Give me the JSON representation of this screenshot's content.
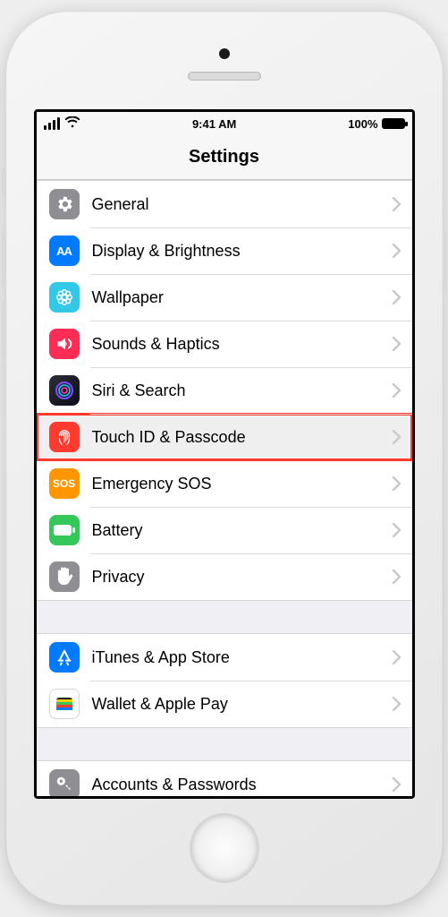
{
  "status_bar": {
    "time": "9:41 AM",
    "battery_pct": "100%"
  },
  "header": {
    "title": "Settings"
  },
  "groups": [
    {
      "items": [
        {
          "id": "general",
          "label": "General"
        },
        {
          "id": "display-brightness",
          "label": "Display & Brightness"
        },
        {
          "id": "wallpaper",
          "label": "Wallpaper"
        },
        {
          "id": "sounds-haptics",
          "label": "Sounds & Haptics"
        },
        {
          "id": "siri-search",
          "label": "Siri & Search"
        },
        {
          "id": "touch-id-passcode",
          "label": "Touch ID & Passcode",
          "highlight": true
        },
        {
          "id": "emergency-sos",
          "label": "Emergency SOS"
        },
        {
          "id": "battery",
          "label": "Battery"
        },
        {
          "id": "privacy",
          "label": "Privacy"
        }
      ]
    },
    {
      "items": [
        {
          "id": "itunes-app-store",
          "label": "iTunes & App Store"
        },
        {
          "id": "wallet-apple-pay",
          "label": "Wallet & Apple Pay"
        }
      ]
    },
    {
      "items": [
        {
          "id": "accounts-passwords",
          "label": "Accounts & Passwords"
        }
      ]
    }
  ]
}
